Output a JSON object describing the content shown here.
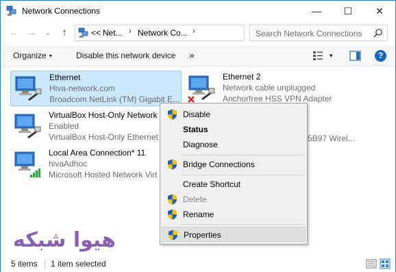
{
  "window": {
    "title": "Network Connections",
    "controls": {
      "minimize": "—",
      "maximize": "☐",
      "close": "✕"
    }
  },
  "nav": {
    "back": "←",
    "forward": "→",
    "history": "⌄",
    "up": "↑"
  },
  "address": {
    "overflow": "<<",
    "segments": [
      "Net...",
      "Network Co..."
    ],
    "separator": "›",
    "dropdown": "▾",
    "refresh": "↻"
  },
  "search": {
    "placeholder": "Search Network Connections"
  },
  "commandbar": {
    "organize": "Organize",
    "organize_caret": "▾",
    "disable": "Disable this network device",
    "more": "»",
    "view_caret": "▾",
    "help": "?"
  },
  "items": [
    {
      "name": "Ethernet",
      "status": "Hiva-network.com",
      "device": "Broadcom NetLink (TM) Gigabit E...",
      "selected": true,
      "signal": "cable"
    },
    {
      "name": "Ethernet 2",
      "status": "Network cable unplugged",
      "device": "Anchorfree HSS VPN Adapter",
      "selected": false,
      "signal": "unplugged"
    },
    {
      "name": "VirtualBox Host-Only Network",
      "status": "Enabled",
      "device": "VirtualBox Host-Only Ethernet",
      "selected": false,
      "signal": "cable"
    },
    {
      "name": "Local Area Connection* 11",
      "status": "hivaAdhoc",
      "device": "Microsoft Hosted Network Virt",
      "selected": false,
      "signal": "wireless"
    },
    {
      "partial_device": "5B97 Wirel..."
    }
  ],
  "context_menu": [
    {
      "label": "Disable",
      "shield": true,
      "bold": false,
      "disabled": false
    },
    {
      "label": "Status",
      "shield": false,
      "bold": true,
      "disabled": false
    },
    {
      "label": "Diagnose",
      "shield": false,
      "bold": false,
      "disabled": false
    },
    {
      "label": "Bridge Connections",
      "shield": true,
      "bold": false,
      "disabled": false
    },
    {
      "label": "Create Shortcut",
      "shield": false,
      "bold": false,
      "disabled": false
    },
    {
      "label": "Delete",
      "shield": true,
      "bold": false,
      "disabled": true
    },
    {
      "label": "Rename",
      "shield": true,
      "bold": false,
      "disabled": false
    },
    {
      "label": "Properties",
      "shield": true,
      "bold": false,
      "disabled": false,
      "highlighted": true
    }
  ],
  "watermark": "هیوا شبکه",
  "statusbar": {
    "count": "5 items",
    "selected": "1 item selected"
  },
  "colors": {
    "accent": "#1883d7",
    "selection": "#cce8ff",
    "watermark": "#8a60b3",
    "shield_blue": "#1f5fbf",
    "shield_yellow": "#f2c200"
  }
}
